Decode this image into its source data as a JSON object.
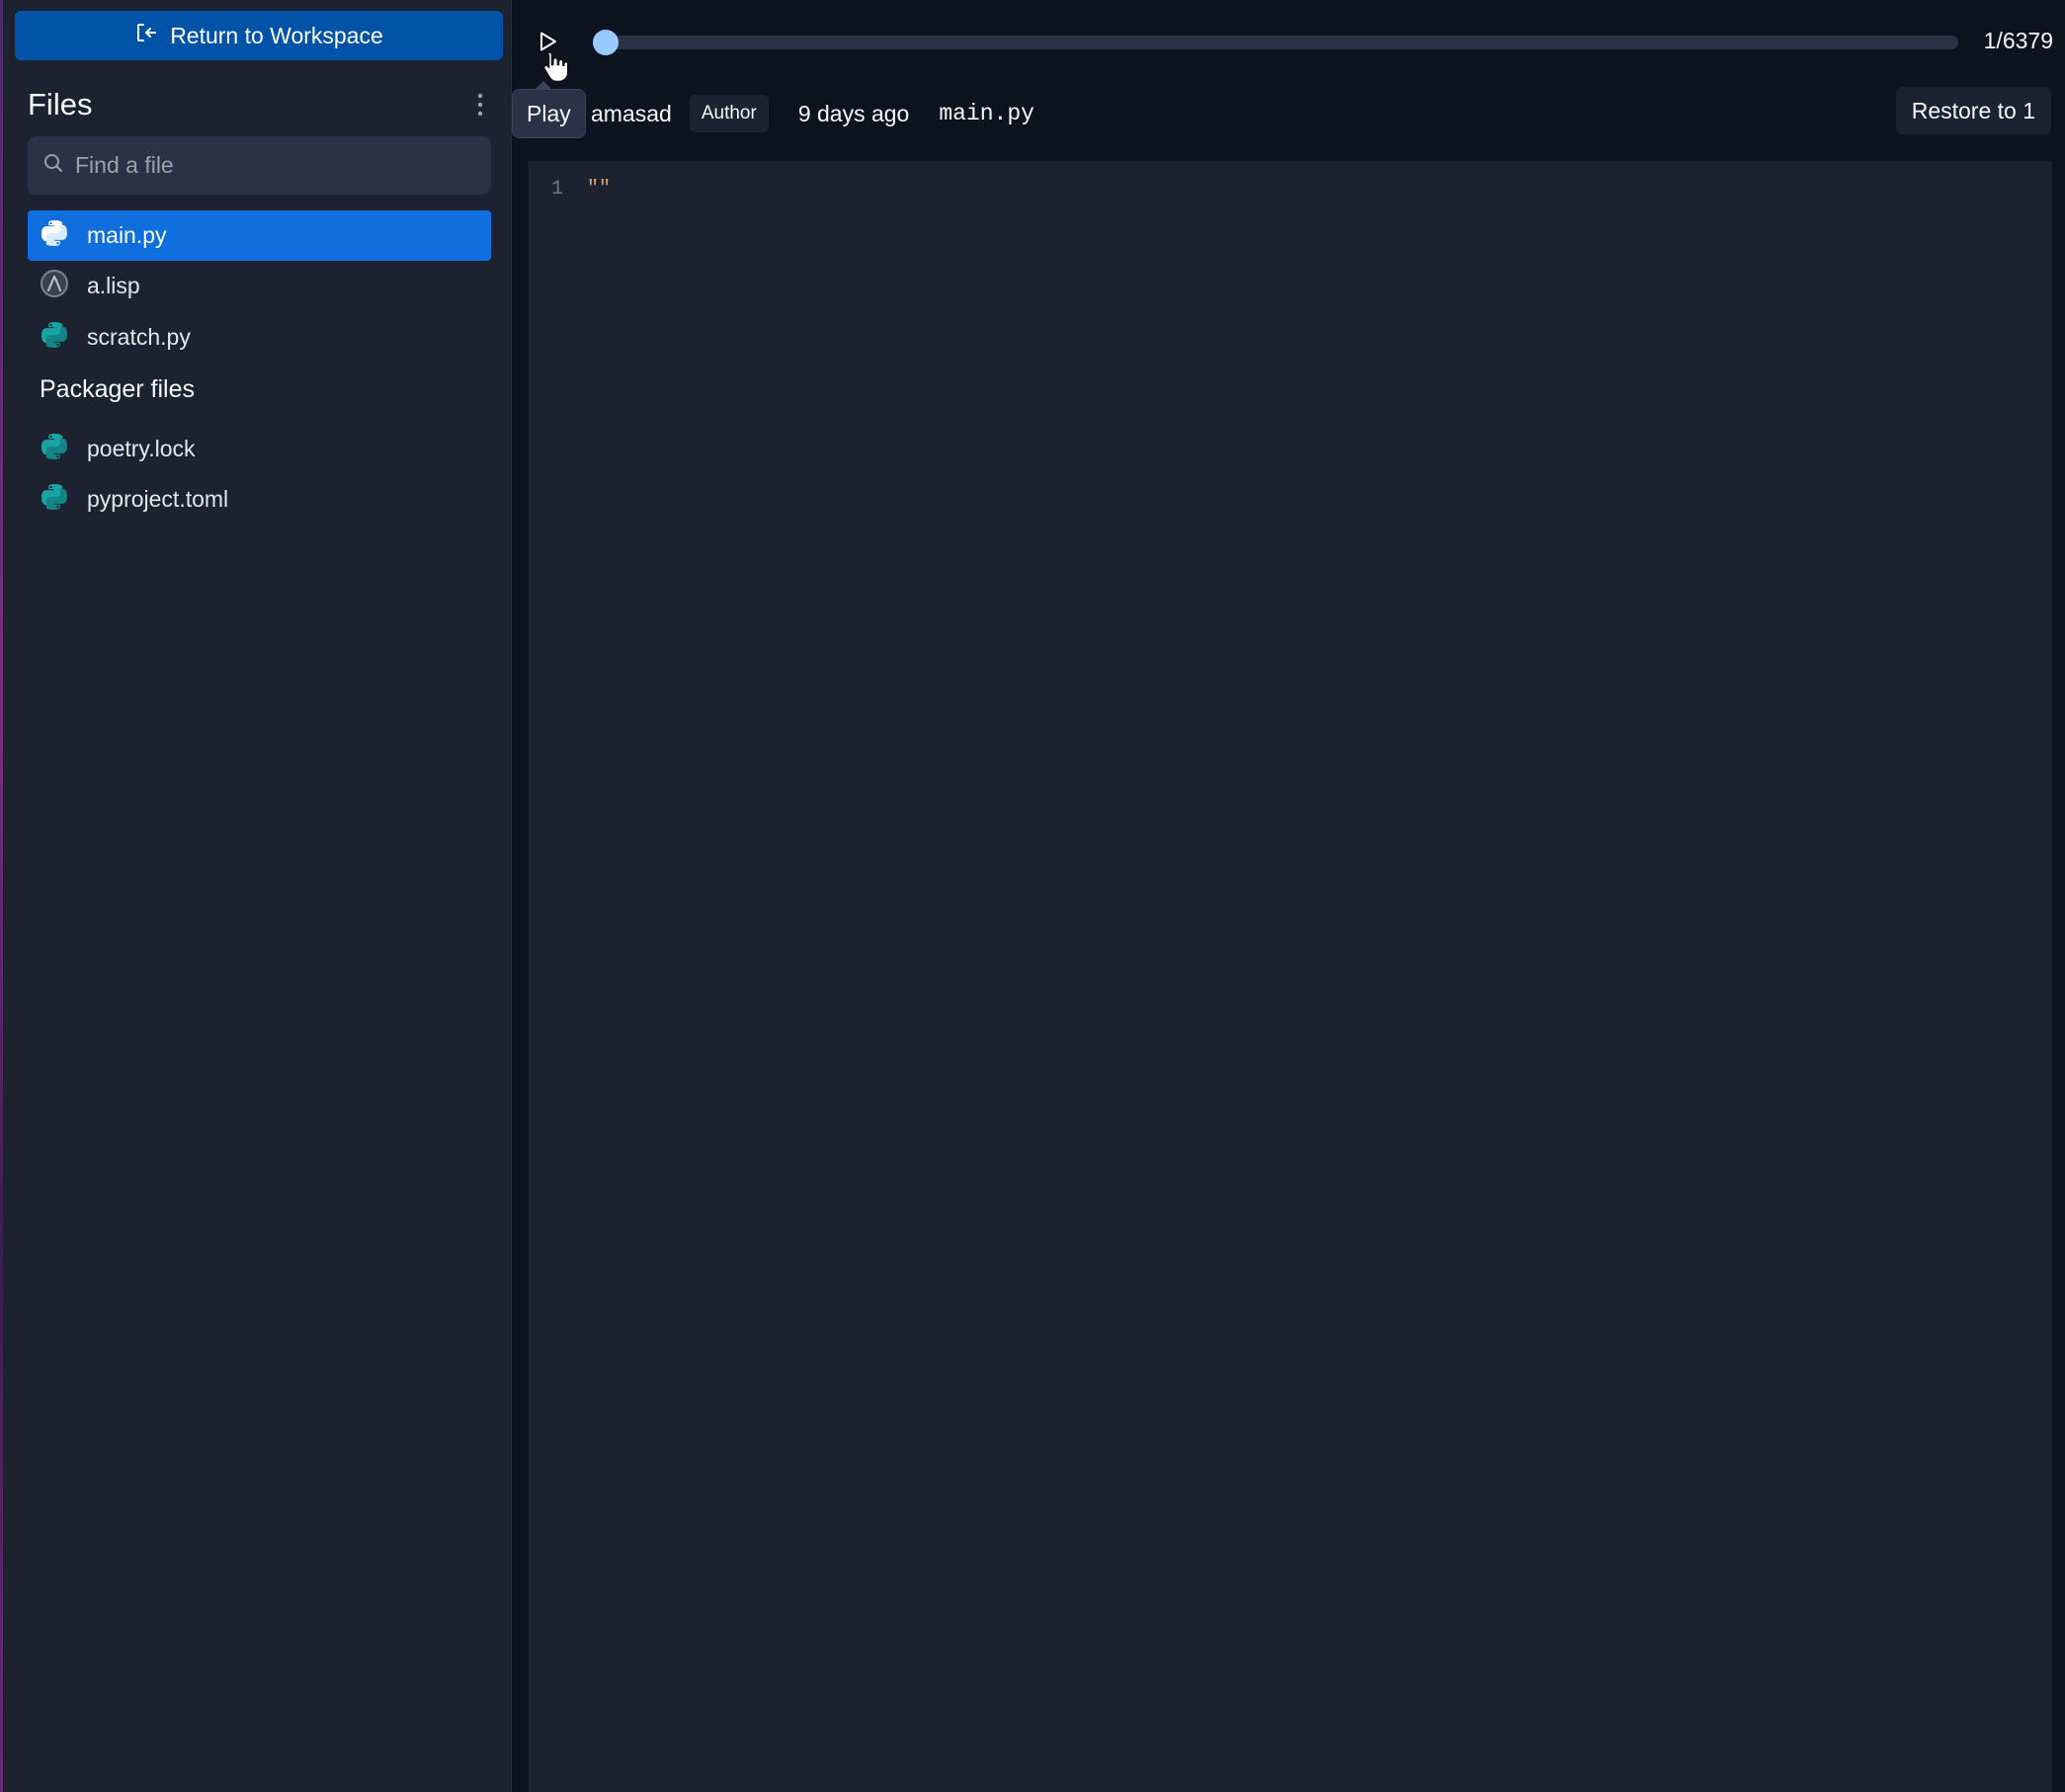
{
  "sidebar": {
    "return_label": "Return to Workspace",
    "files_title": "Files",
    "search_placeholder": "Find a file",
    "files": [
      {
        "name": "main.py",
        "icon": "python-icon",
        "active": true
      },
      {
        "name": "a.lisp",
        "icon": "lisp-icon",
        "active": false
      },
      {
        "name": "scratch.py",
        "icon": "python-icon",
        "active": false
      }
    ],
    "packager_title": "Packager files",
    "packager_files": [
      {
        "name": "poetry.lock",
        "icon": "python-icon"
      },
      {
        "name": "pyproject.toml",
        "icon": "python-icon"
      }
    ]
  },
  "history": {
    "play_tooltip": "Play",
    "step_counter": "1/6379",
    "current_step": 1,
    "total_steps": 6379,
    "author": "amasad",
    "author_badge": "Author",
    "time_ago": "9 days ago",
    "file_name": "main.py",
    "restore_label": "Restore to 1"
  },
  "editor": {
    "lines": [
      {
        "number": "1",
        "code": "\"\""
      }
    ]
  },
  "colors": {
    "accent": "#0f6fde",
    "return_button": "#0053a6",
    "python_icon": "#1aa3a3",
    "timeline_thumb": "#99c9ff",
    "string_token": "#d8a66a"
  }
}
